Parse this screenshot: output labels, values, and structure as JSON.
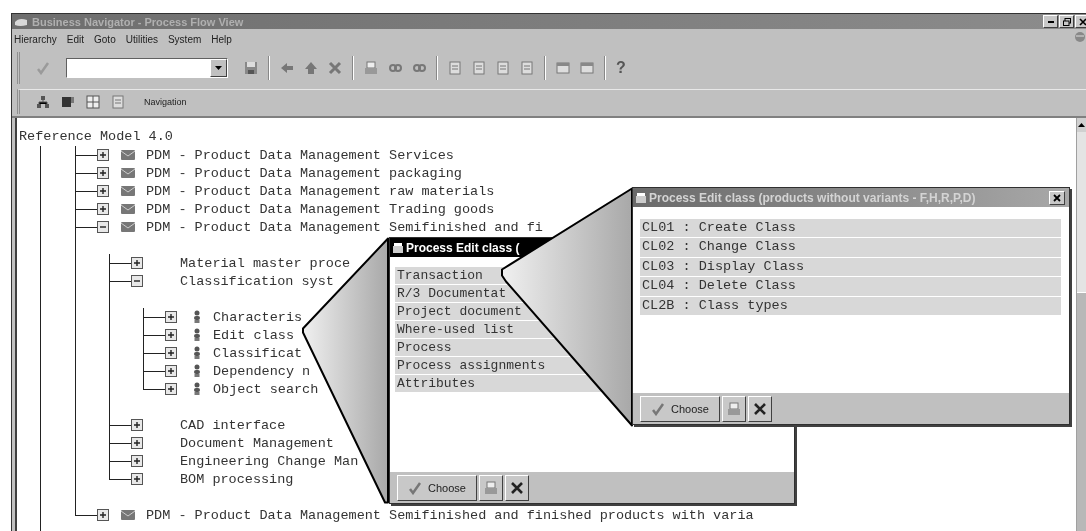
{
  "window": {
    "title": "Business Navigator - Process Flow View"
  },
  "menu": [
    {
      "label": "Hierarchy"
    },
    {
      "label": "Edit"
    },
    {
      "label": "Goto"
    },
    {
      "label": "Utilities"
    },
    {
      "label": "System"
    },
    {
      "label": "Help"
    }
  ],
  "toolbar": {
    "help": "?"
  },
  "nav_toolbar": {
    "label": "Navigation"
  },
  "tree": {
    "root": "Reference Model 4.0",
    "items": [
      {
        "label": "PDM - Product Data Management Services",
        "kind": "folder",
        "expanded": false
      },
      {
        "label": "PDM - Product Data Management packaging",
        "kind": "folder",
        "expanded": false
      },
      {
        "label": "PDM - Product Data Management raw materials",
        "kind": "folder",
        "expanded": false
      },
      {
        "label": "PDM - Product Data Management Trading goods",
        "kind": "folder",
        "expanded": false
      },
      {
        "label": "PDM - Product Data Management Semifinished and fi",
        "kind": "folder",
        "expanded": true,
        "children": [
          {
            "label": "Material master proce",
            "kind": "plain",
            "expanded": false
          },
          {
            "label": "Classification syst",
            "kind": "plain",
            "expanded": true,
            "children": [
              {
                "label": "Characteris",
                "kind": "person",
                "expanded": false
              },
              {
                "label": "Edit class",
                "kind": "person",
                "expanded": false
              },
              {
                "label": "Classificat",
                "kind": "person",
                "expanded": false
              },
              {
                "label": "Dependency n",
                "kind": "person",
                "expanded": false
              },
              {
                "label": "Object search",
                "kind": "person",
                "expanded": false
              }
            ]
          },
          {
            "label": "CAD interface",
            "kind": "plain",
            "expanded": false
          },
          {
            "label": "Document Management",
            "kind": "plain",
            "expanded": false
          },
          {
            "label": "Engineering Change Man",
            "kind": "plain",
            "expanded": false
          },
          {
            "label": "BOM processing",
            "kind": "plain",
            "expanded": false
          }
        ]
      },
      {
        "label": "PDM - Product Data Management Semifinished and finished products with varia",
        "kind": "folder",
        "expanded": false
      }
    ]
  },
  "popups": [
    {
      "title": "Process Edit class (",
      "active": true,
      "items": [
        "Transaction",
        "R/3 Documentat",
        "Project document",
        "Where-used list",
        "Process",
        "Process assignments",
        "Attributes"
      ],
      "choose": "Choose"
    },
    {
      "title": "Process Edit class (products without variants - F,H,R,P,D)",
      "active": false,
      "close_button": true,
      "items": [
        "CL01 : Create Class",
        "CL02 : Change Class",
        "CL03 : Display Class",
        "CL04 : Delete Class",
        "CL2B : Class types"
      ],
      "choose": "Choose"
    }
  ]
}
